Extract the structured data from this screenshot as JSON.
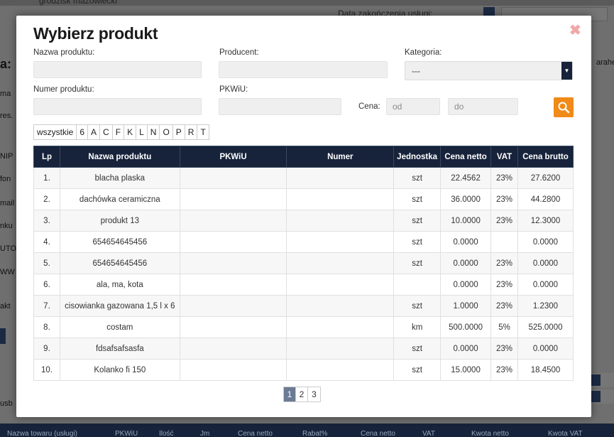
{
  "background": {
    "top_field_text": "grodzisk mazowiecki",
    "date_label": "Data zakończenia usługi:",
    "left_heading": "a:",
    "left_labels": [
      "ma",
      "res.",
      "NIP",
      "fon",
      "mail",
      "nku",
      "UTO",
      "WW",
      "akt"
    ],
    "right_label": "arahen",
    "bottom_left_label": "usb",
    "bottom_headers": [
      "Nazwa towaru (usługi)",
      "PKWiU",
      "Ilość",
      "Jm",
      "Cena netto",
      "Rabat%",
      "Cena netto",
      "VAT",
      "Kwota netto",
      "Kwota VAT"
    ]
  },
  "modal": {
    "title": "Wybierz produkt",
    "close_symbol": "✖",
    "filters": {
      "product_name_label": "Nazwa produktu:",
      "producer_label": "Producent:",
      "category_label": "Kategoria:",
      "category_value": "---",
      "product_number_label": "Numer produktu:",
      "pkwiu_label": "PKWiU:",
      "price_label": "Cena:",
      "price_from_placeholder": "od",
      "price_to_placeholder": "do"
    },
    "letters": [
      "wszystkie",
      "6",
      "A",
      "C",
      "F",
      "K",
      "L",
      "N",
      "O",
      "P",
      "R",
      "T"
    ],
    "table": {
      "headers": [
        "Lp",
        "Nazwa produktu",
        "PKWiU",
        "Numer",
        "Jednostka",
        "Cena netto",
        "VAT",
        "Cena brutto"
      ],
      "rows": [
        [
          "1.",
          "blacha plaska",
          "",
          "",
          "szt",
          "22.4562",
          "23%",
          "27.6200"
        ],
        [
          "2.",
          "dachówka ceramiczna",
          "",
          "",
          "szt",
          "36.0000",
          "23%",
          "44.2800"
        ],
        [
          "3.",
          "produkt 13",
          "",
          "",
          "szt",
          "10.0000",
          "23%",
          "12.3000"
        ],
        [
          "4.",
          "654654645456",
          "",
          "",
          "szt",
          "0.0000",
          "",
          "0.0000"
        ],
        [
          "5.",
          "654654645456",
          "",
          "",
          "szt",
          "0.0000",
          "23%",
          "0.0000"
        ],
        [
          "6.",
          "ala, ma, kota",
          "",
          "",
          "",
          "0.0000",
          "23%",
          "0.0000"
        ],
        [
          "7.",
          "cisowianka gazowana 1,5 l x 6",
          "",
          "",
          "szt",
          "1.0000",
          "23%",
          "1.2300"
        ],
        [
          "8.",
          "costam",
          "",
          "",
          "km",
          "500.0000",
          "5%",
          "525.0000"
        ],
        [
          "9.",
          "fdsafsafsasfa",
          "",
          "",
          "szt",
          "0.0000",
          "23%",
          "0.0000"
        ],
        [
          "10.",
          "Kolanko fi 150",
          "",
          "",
          "szt",
          "15.0000",
          "23%",
          "18.4500"
        ]
      ]
    },
    "pagination": [
      "1",
      "2",
      "3"
    ],
    "active_page": "1"
  },
  "colors": {
    "header_navy": "#17233a",
    "search_orange": "#f08a18",
    "close_pink": "#f0a8a8"
  }
}
